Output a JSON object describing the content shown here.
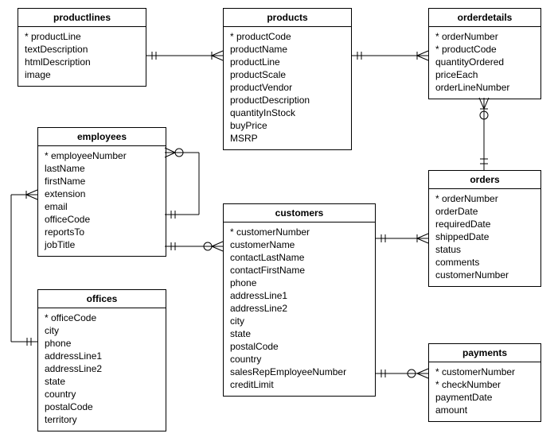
{
  "entities": {
    "productlines": {
      "title": "productlines",
      "fields": [
        "* productLine",
        "textDescription",
        "htmlDescription",
        "image"
      ]
    },
    "products": {
      "title": "products",
      "fields": [
        "* productCode",
        "productName",
        "productLine",
        "productScale",
        "productVendor",
        "productDescription",
        "quantityInStock",
        "buyPrice",
        "MSRP"
      ]
    },
    "orderdetails": {
      "title": "orderdetails",
      "fields": [
        "* orderNumber",
        "* productCode",
        "quantityOrdered",
        "priceEach",
        "orderLineNumber"
      ]
    },
    "employees": {
      "title": "employees",
      "fields": [
        "* employeeNumber",
        "lastName",
        "firstName",
        "extension",
        "email",
        "officeCode",
        "reportsTo",
        "jobTitle"
      ]
    },
    "customers": {
      "title": "customers",
      "fields": [
        "* customerNumber",
        "customerName",
        "contactLastName",
        "contactFirstName",
        "phone",
        "addressLine1",
        "addressLine2",
        "city",
        "state",
        "postalCode",
        "country",
        "salesRepEmployeeNumber",
        "creditLimit"
      ]
    },
    "orders": {
      "title": "orders",
      "fields": [
        "* orderNumber",
        "orderDate",
        "requiredDate",
        "shippedDate",
        "status",
        "comments",
        "customerNumber"
      ]
    },
    "offices": {
      "title": "offices",
      "fields": [
        "* officeCode",
        "city",
        "phone",
        "addressLine1",
        "addressLine2",
        "state",
        "country",
        "postalCode",
        "territory"
      ]
    },
    "payments": {
      "title": "payments",
      "fields": [
        "* customerNumber",
        "* checkNumber",
        "paymentDate",
        "amount"
      ]
    }
  }
}
